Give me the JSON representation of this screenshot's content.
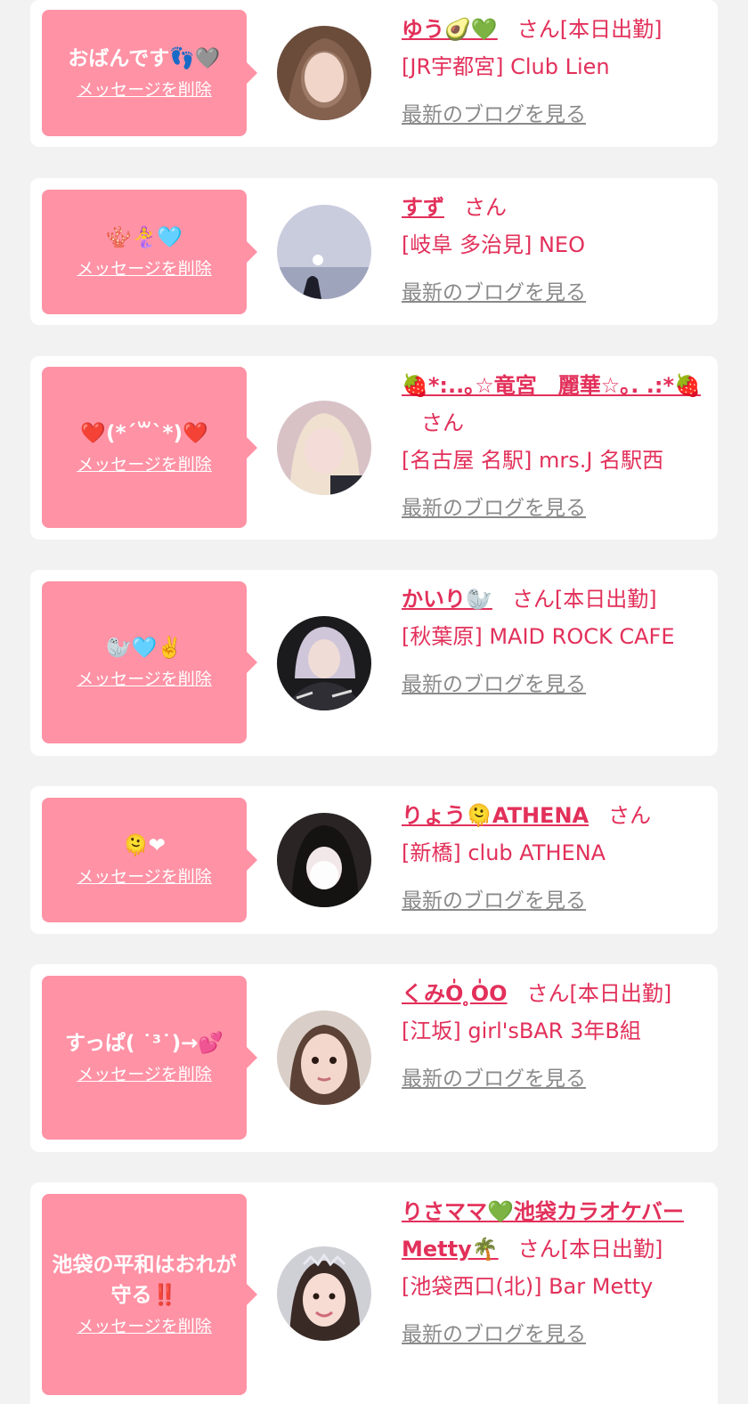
{
  "delete_label": "メッセージを削除",
  "blog_label": "最新のブログを見る",
  "san_label": "さん",
  "colors": {
    "accent": "#e2305a",
    "bubble": "#ff92a5",
    "background": "#f2f2f2",
    "link_gray": "#8a8a8a"
  },
  "cards": [
    {
      "message": "おばんです👣🩶",
      "name": "ゆう🥑💚",
      "status": "[本日出勤]",
      "shop": "[JR宇都宮] Club Lien"
    },
    {
      "message": "🪸🧜‍♀️🩵",
      "name": "すず",
      "status": "",
      "shop": "[岐阜 多治見] NEO"
    },
    {
      "message": "❤️(*´꒳`*)❤️",
      "name": "🍓*:..｡☆竜宮　麗華☆｡. .:*🍓",
      "status": "",
      "shop": "[名古屋 名駅] mrs.J 名駅西"
    },
    {
      "message": "🦭🩵✌️",
      "name": "かいり🦭",
      "status": "[本日出勤]",
      "shop": "[秋葉原] MAID ROCK CAFE"
    },
    {
      "message": "🫠❤",
      "name": "りょう🫠ATHENA",
      "status": "",
      "shop": "[新橋] club ATHENA"
    },
    {
      "message": "すっぱ( ˙³˙)→💕",
      "name": "くみO̍ ̥O̍O",
      "status": "[本日出勤]",
      "shop": "[江坂] girl'sBAR 3年B組"
    },
    {
      "message": "池袋の平和はおれが守る‼️",
      "name": "りさママ💚池袋カラオケバーMetty🌴",
      "status": "[本日出勤]",
      "shop": "[池袋西口(北)] Bar Metty"
    }
  ]
}
